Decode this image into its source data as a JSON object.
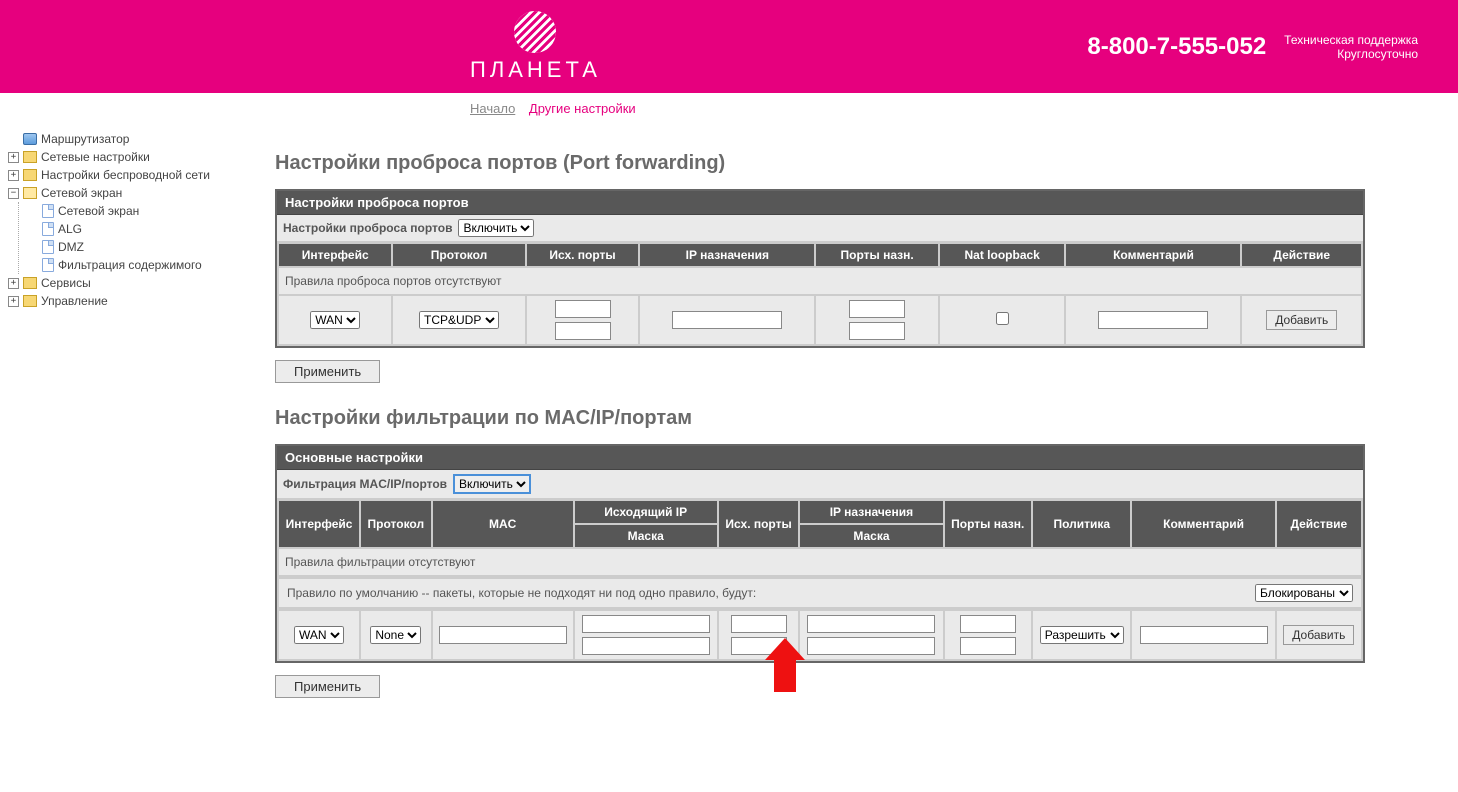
{
  "header": {
    "brand": "ПЛАНЕТА",
    "phone": "8-800-7-555-052",
    "support_line1": "Техническая поддержка",
    "support_line2": "Круглосуточно"
  },
  "breadcrumb": {
    "home": "Начало",
    "current": "Другие настройки"
  },
  "sidebar": {
    "root": "Маршрутизатор",
    "network": "Сетевые настройки",
    "wireless": "Настройки беспроводной сети",
    "firewall": "Сетевой экран",
    "fw_items": {
      "firewall": "Сетевой экран",
      "alg": "ALG",
      "dmz": "DMZ",
      "content_filter": "Фильтрация содержимого"
    },
    "services": "Сервисы",
    "management": "Управление"
  },
  "portfwd": {
    "title": "Настройки проброса портов (Port forwarding)",
    "panel_title": "Настройки проброса портов",
    "toggle_label": "Настройки проброса портов",
    "toggle_value": "Включить",
    "cols": {
      "iface": "Интерфейс",
      "proto": "Протокол",
      "src_ports": "Исх. порты",
      "dst_ip": "IP назначения",
      "dst_ports": "Порты назн.",
      "nat": "Nat loopback",
      "comment": "Комментарий",
      "action": "Действие"
    },
    "empty_msg": "Правила проброса портов отсутствуют",
    "iface_value": "WAN",
    "proto_value": "TCP&UDP",
    "add_btn": "Добавить",
    "apply_btn": "Применить"
  },
  "filter": {
    "title": "Настройки фильтрации по MAC/IP/портам",
    "panel_title": "Основные настройки",
    "toggle_label": "Фильтрация MAC/IP/портов",
    "toggle_value": "Включить",
    "cols": {
      "iface": "Интерфейс",
      "proto": "Протокол",
      "mac": "MAC",
      "src_ip": "Исходящий IP",
      "mask": "Маска",
      "src_ports": "Исх. порты",
      "dst_ip": "IP назначения",
      "dst_ports": "Порты назн.",
      "policy": "Политика",
      "comment": "Комментарий",
      "action": "Действие"
    },
    "empty_msg": "Правила фильтрации отсутствуют",
    "default_rule_text": "Правило по умолчанию -- пакеты, которые не подходят ни под одно правило, будут:",
    "default_rule_value": "Блокированы",
    "iface_value": "WAN",
    "proto_value": "None",
    "policy_value": "Разрешить",
    "add_btn": "Добавить",
    "apply_btn": "Применить"
  }
}
